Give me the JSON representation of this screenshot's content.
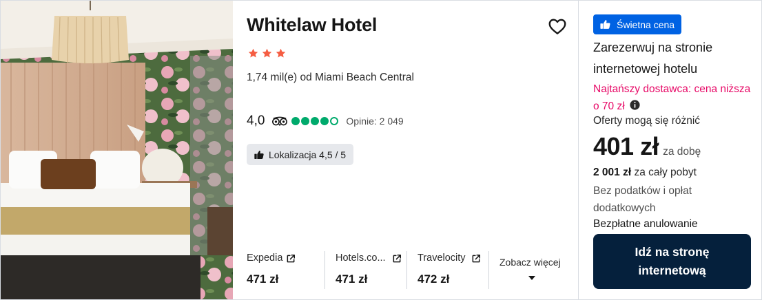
{
  "hotel": {
    "name": "Whitelaw Hotel",
    "stars": 3,
    "distance": "1,74 mil(e) od Miami Beach Central",
    "rating_score": "4,0",
    "rating_bubbles": 4,
    "reviews": "Opinie: 2 049",
    "location_chip": "Lokalizacja 4,5 / 5",
    "photo_icon": "hotel-room-photo"
  },
  "providers": [
    {
      "name": "Expedia",
      "price": "471 zł"
    },
    {
      "name": "Hotels.co...",
      "price": "471 zł"
    },
    {
      "name": "Travelocity",
      "price": "472 zł"
    }
  ],
  "see_more_label": "Zobacz więcej",
  "deal": {
    "badge": "Świetna cena",
    "book_text": "Zarezerwuj na stronie internetowej hotelu",
    "cheapest": "Najtańszy dostawca: cena niższa o 70 zł",
    "offers_differ": "Oferty mogą się różnić",
    "price": "401 zł",
    "per_night": "za dobę",
    "total_amount": "2 001 zł",
    "total_suffix": "za cały pobyt",
    "taxes": "Bez podatków i opłat dodatkowych",
    "free_cancel": "Bezpłatne anulowanie",
    "cta": "Idź na stronę internetową"
  },
  "colors": {
    "star": "#f55d42",
    "tripadvisor_green": "#00aa6c",
    "badge_blue": "#0062e3",
    "cheapest_pink": "#e70866",
    "cta_navy": "#05203c"
  },
  "icons": [
    "heart-icon",
    "star-icon",
    "tripadvisor-owl-icon",
    "thumbs-up-icon",
    "external-link-icon",
    "chevron-down-icon",
    "info-icon"
  ]
}
